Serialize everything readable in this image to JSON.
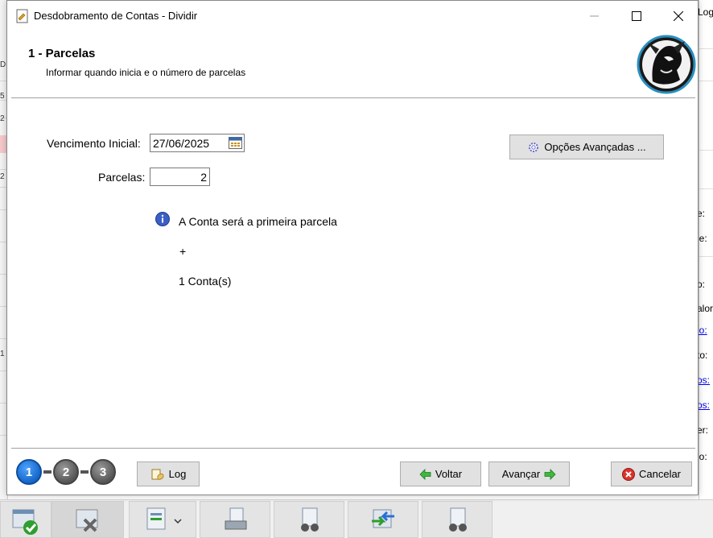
{
  "window": {
    "title": "Desdobramento de Contas - Dividir"
  },
  "header": {
    "title": "1 - Parcelas",
    "subtitle": "Informar quando inicia e o número de parcelas"
  },
  "form": {
    "vencimento_label": "Vencimento Inicial:",
    "vencimento_value": "27/06/2025",
    "parcelas_label": "Parcelas:",
    "parcelas_value": "2"
  },
  "advanced_button": "Opções Avançadas ...",
  "info": {
    "line1": "A Conta será a primeira parcela",
    "line2": "+",
    "line3": "1 Conta(s)"
  },
  "wizard": {
    "steps": [
      "1",
      "2",
      "3"
    ],
    "active_step": "1"
  },
  "footer": {
    "log_label": "Log",
    "back_label": "Voltar",
    "next_label": "Avançar",
    "cancel_label": "Cancelar"
  },
  "background": {
    "right_labels": [
      "e:",
      "le:",
      "o:",
      "alor",
      "io:",
      "to:",
      "os:",
      "os:",
      "er:",
      "io:"
    ],
    "top_right_label": "Log",
    "left_chars": [
      "D",
      "5",
      "2",
      "2",
      "1"
    ]
  },
  "colors": {
    "accent_blue": "#1466c8",
    "step_inactive": "#555555",
    "arrow_green": "#2e9e2e",
    "cancel_red": "#d9342b"
  }
}
